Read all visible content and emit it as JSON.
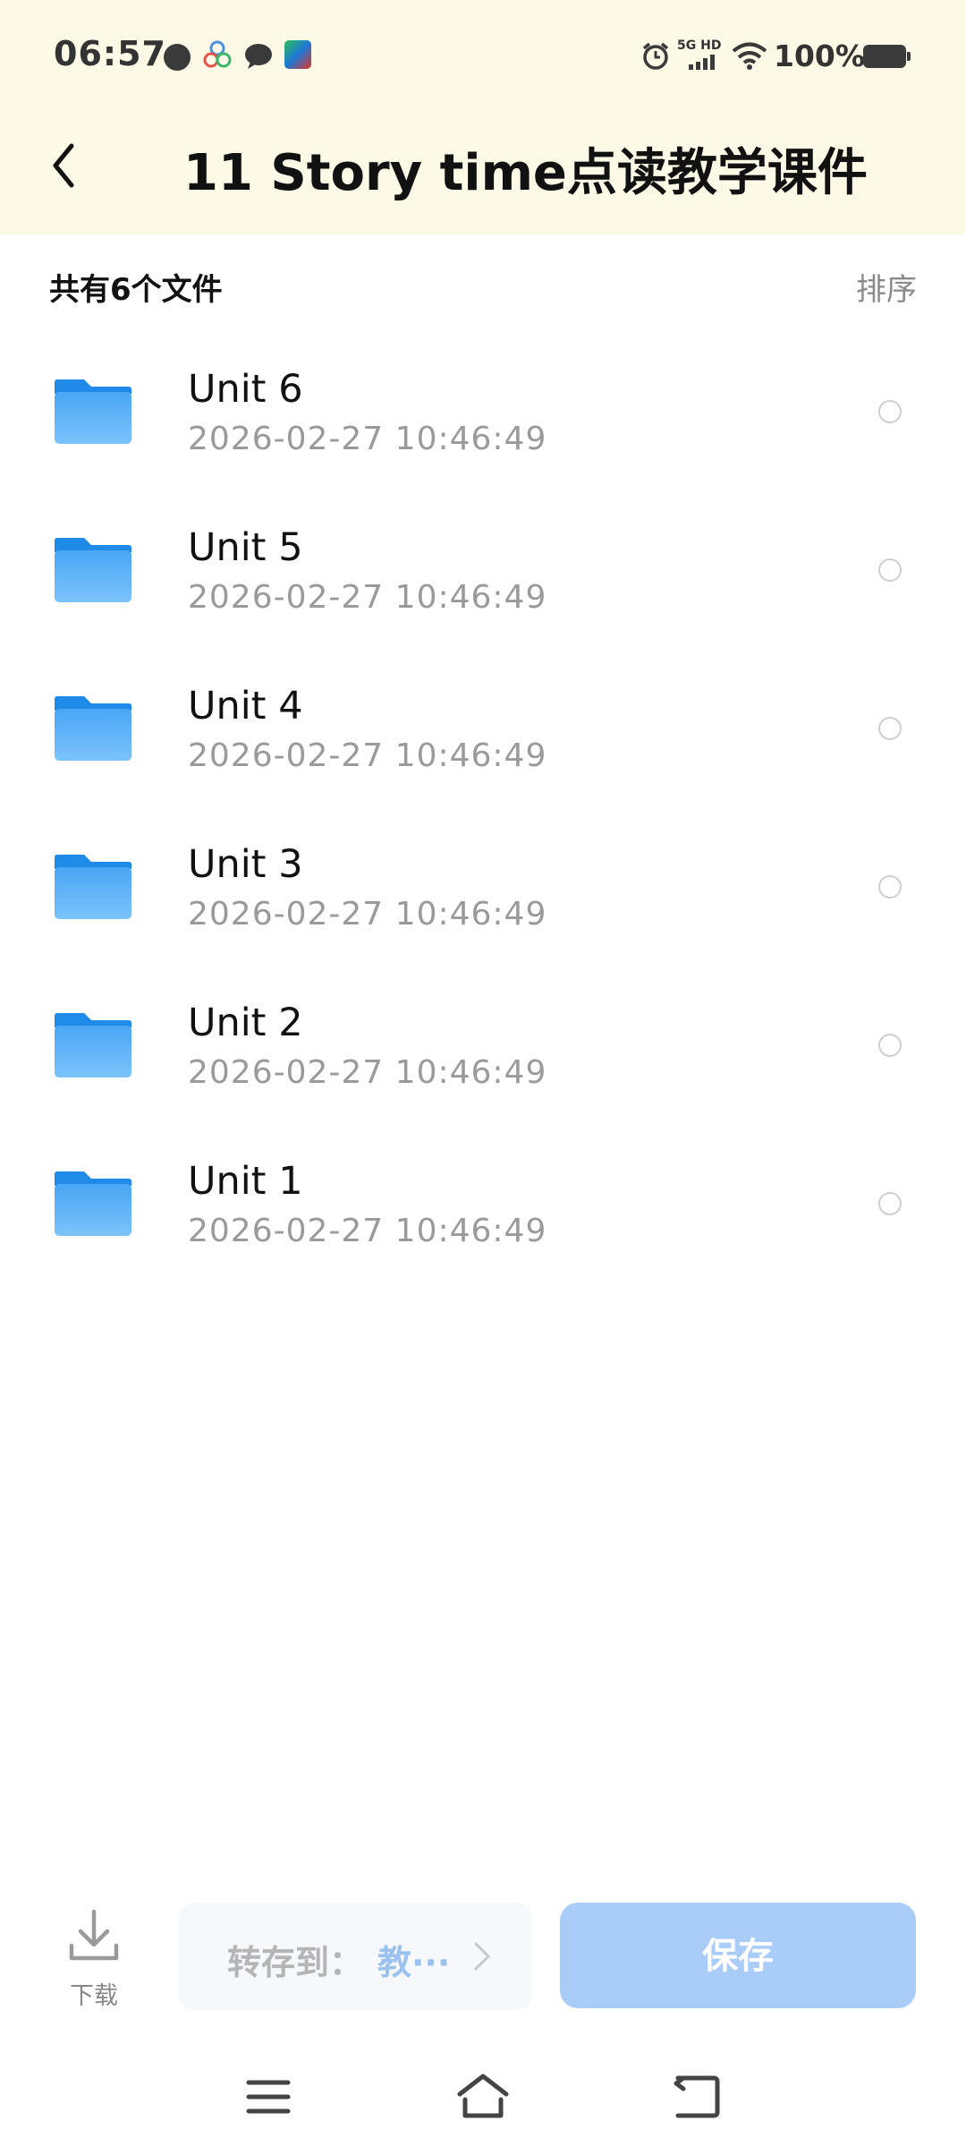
{
  "status_bar": {
    "time": "06:57",
    "network": "5G HD",
    "battery": "100%",
    "icons": [
      "dot-icon",
      "app-icon",
      "chat-icon",
      "game-icon",
      "alarm-icon",
      "signal-icon",
      "wifi-icon",
      "battery-icon"
    ]
  },
  "header": {
    "title": "11 Story time点读教学课件",
    "back_icon": "back-arrow-icon"
  },
  "summary": {
    "count_label": "共有6个文件",
    "sort_label": "排序"
  },
  "files": [
    {
      "name": "Unit 6",
      "date": "2026-02-27  10:46:49"
    },
    {
      "name": "Unit 5",
      "date": "2026-02-27  10:46:49"
    },
    {
      "name": "Unit 4",
      "date": "2026-02-27  10:46:49"
    },
    {
      "name": "Unit 3",
      "date": "2026-02-27  10:46:49"
    },
    {
      "name": "Unit 2",
      "date": "2026-02-27  10:46:49"
    },
    {
      "name": "Unit 1",
      "date": "2026-02-27  10:46:49"
    }
  ],
  "bottom_bar": {
    "download_label": "下载",
    "saveto_label": "转存到：",
    "saveto_target": "教···",
    "save_label": "保存"
  },
  "colors": {
    "header_bg": "#fcf9e6",
    "folder_blue": "#3a9cf0",
    "save_button": "#a9cdf8"
  }
}
